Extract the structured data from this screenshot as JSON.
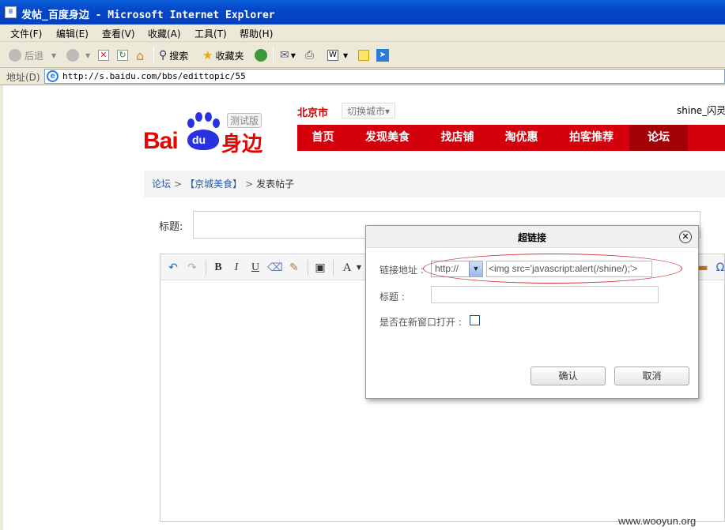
{
  "window": {
    "title": "发帖_百度身边 - Microsoft Internet Explorer"
  },
  "menubar": [
    "文件(F)",
    "编辑(E)",
    "查看(V)",
    "收藏(A)",
    "工具(T)",
    "帮助(H)"
  ],
  "toolbar": {
    "back": "后退",
    "search": "搜索",
    "favorites": "收藏夹"
  },
  "address": {
    "label": "地址(D)",
    "url": "http://s.baidu.com/bbs/edittopic/55"
  },
  "logo": {
    "bai": "Bai",
    "du": "du",
    "shenbian": "身边",
    "beta": "测试版"
  },
  "header": {
    "city": "北京市",
    "switch_city": "切换城市▾",
    "user": "shine_闪灵"
  },
  "nav": [
    "首页",
    "发现美食",
    "找店铺",
    "淘优惠",
    "拍客推荐",
    "论坛"
  ],
  "breadcrumb": {
    "forum": "论坛",
    "board": "【京城美食】",
    "current": "发表帖子"
  },
  "form": {
    "title_label": "标题:"
  },
  "dialog": {
    "title": "超链接",
    "link_label": "链接地址 :",
    "protocol": "http://",
    "link_value": "<img src='javascript:alert(/shine/);'>",
    "title_label": "标题 :",
    "new_window_label": "是否在新窗口打开 :",
    "ok": "确认",
    "cancel": "取消"
  },
  "watermark": "www.wooyun.org",
  "colors": {
    "nav_red": "#d4000b",
    "nav_active": "#a30008",
    "annotation": "#d4343c"
  }
}
